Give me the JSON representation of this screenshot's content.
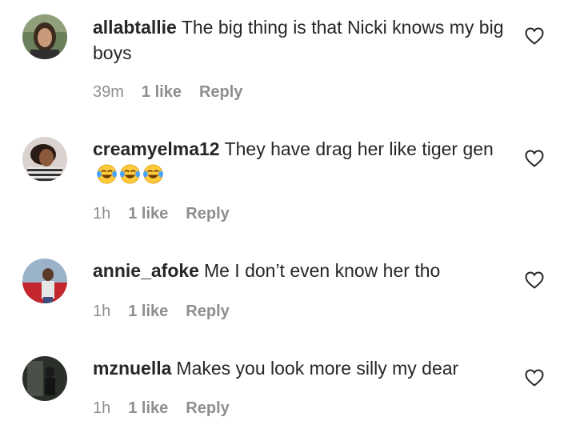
{
  "comments": [
    {
      "username": "allabtallie",
      "text": "The big thing is that Nicki knows my big boys",
      "time": "39m",
      "likes": "1 like",
      "reply": "Reply"
    },
    {
      "username": "creamyelma12",
      "text": "They have drag her like tiger gen",
      "emojis": [
        "face-with-tears-of-joy",
        "face-with-tears-of-joy",
        "face-with-tears-of-joy"
      ],
      "time": "1h",
      "likes": "1 like",
      "reply": "Reply"
    },
    {
      "username": "annie_afoke",
      "text": "Me I don’t even know her tho",
      "time": "1h",
      "likes": "1 like",
      "reply": "Reply"
    },
    {
      "username": "mznuella",
      "text": "Makes you look more silly my dear",
      "time": "1h",
      "likes": "1 like",
      "reply": "Reply"
    }
  ],
  "icons": {
    "like": "heart-outline-icon"
  },
  "colors": {
    "text": "#262626",
    "meta": "#8e8e8e",
    "background": "#ffffff"
  }
}
